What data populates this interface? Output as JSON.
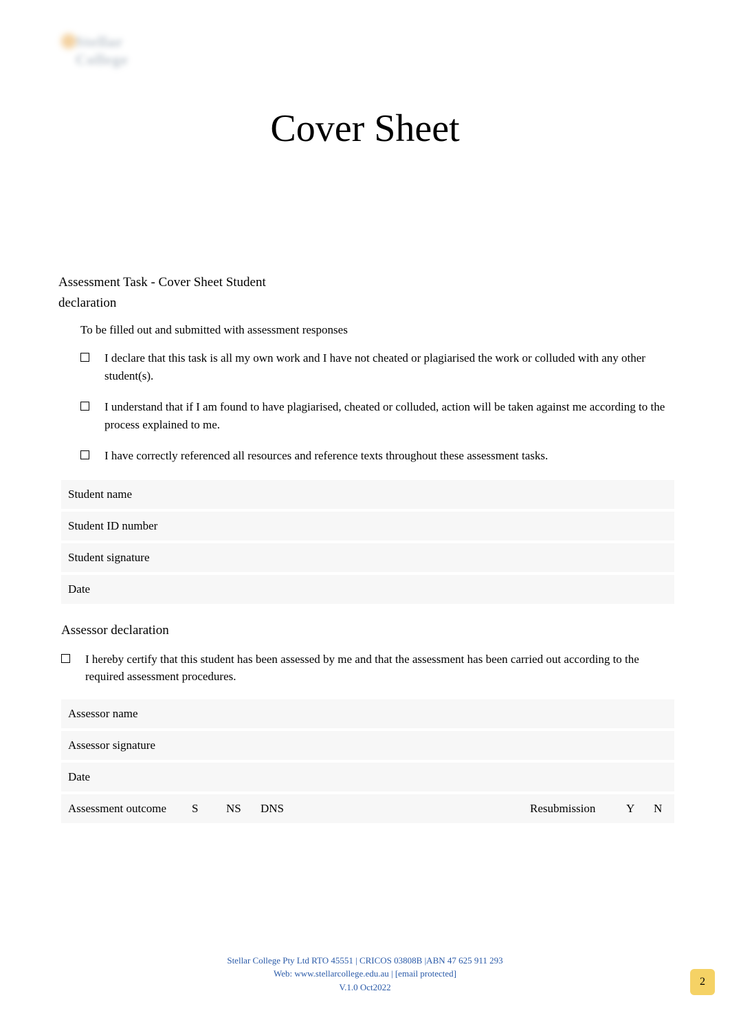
{
  "logo_text": "Stellar College",
  "page_title": "Cover Sheet",
  "section1_heading": "Assessment Task - Cover Sheet Student",
  "section1_sub": "declaration",
  "instruction": "To be filled out and submitted with assessment responses",
  "student_checklist": [
    "I declare that this task is all my own work and I have not cheated or plagiarised the work or colluded with any other student(s).",
    "I understand that if I am found to have plagiarised, cheated or colluded, action will be taken against me according to the process explained to me.",
    "I have correctly referenced all resources and reference texts throughout these assessment tasks."
  ],
  "student_fields": {
    "name_label": "Student name",
    "id_label": "Student ID number",
    "sig_label": "Student signature",
    "date_label": "Date"
  },
  "assessor_heading": "Assessor declaration",
  "assessor_checklist": [
    "I hereby certify that this student has been assessed by me and that the assessment has been carried out according to the required assessment procedures."
  ],
  "assessor_fields": {
    "name_label": "Assessor name",
    "sig_label": "Assessor signature",
    "date_label": "Date",
    "outcome_label": "Assessment outcome",
    "opt_s": "S",
    "opt_ns": "NS",
    "opt_dns": "DNS",
    "resub_label": "Resubmission",
    "opt_y": "Y",
    "opt_n": "N"
  },
  "footer": {
    "line1": "Stellar College Pty Ltd RTO 45551 | CRICOS 03808B |ABN 47 625 911 293",
    "line2": "Web: www.stellarcollege.edu.au   | [email protected]",
    "line3": "V.1.0 Oct2022"
  },
  "page_number": "2"
}
